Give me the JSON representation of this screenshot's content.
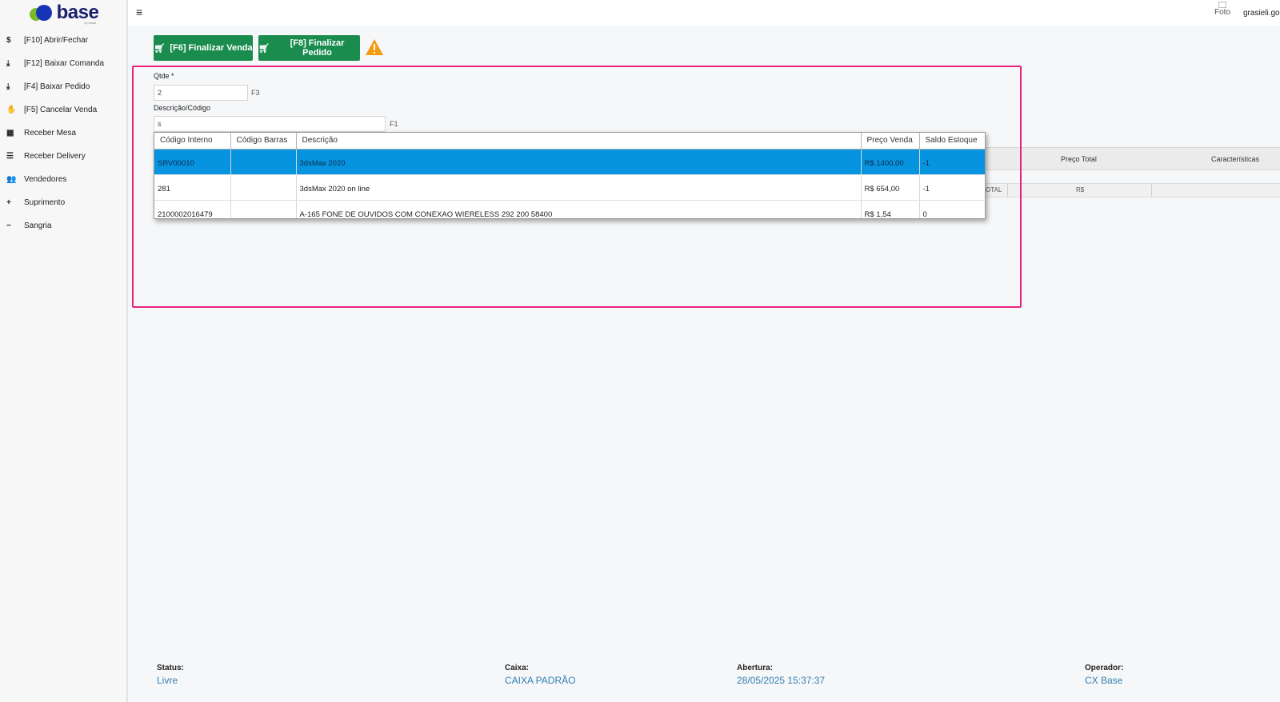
{
  "brand": {
    "logo_text": "base",
    "byline": "by Natal"
  },
  "sidebar": {
    "items": [
      {
        "icon": "dollar-icon",
        "glyph": "$",
        "label": "[F10] Abrir/Fechar"
      },
      {
        "icon": "download-icon",
        "glyph": "⤓",
        "label": "[F12] Baixar Comanda"
      },
      {
        "icon": "download-icon",
        "glyph": "⤓",
        "label": "[F4] Baixar Pedido"
      },
      {
        "icon": "thumbs-down-icon",
        "glyph": "✋",
        "label": "[F5] Cancelar Venda"
      },
      {
        "icon": "grid-icon",
        "glyph": "▦",
        "label": "Receber Mesa"
      },
      {
        "icon": "list-icon",
        "glyph": "☰",
        "label": "Receber Delivery"
      },
      {
        "icon": "users-icon",
        "glyph": "👥",
        "label": "Vendedores"
      },
      {
        "icon": "plus-icon",
        "glyph": "+",
        "label": "Suprimento"
      },
      {
        "icon": "minus-icon",
        "glyph": "−",
        "label": "Sangria"
      }
    ]
  },
  "header": {
    "hamburger": "≡",
    "photo_alt": "Foto",
    "user": "grasieli.gomes"
  },
  "actions": {
    "finalizar_venda": "[F6] Finalizar Venda",
    "finalizar_pedido": "[F8] Finalizar Pedido"
  },
  "form": {
    "qtde_label": "Qtde *",
    "qtde_value": "2",
    "qtde_hint": "F3",
    "desc_label": "Descrição/Código",
    "desc_value": "s",
    "desc_hint": "F1"
  },
  "background_table": {
    "headers": {
      "preco_total": "Preço Total",
      "caracteristicas": "Características"
    },
    "total_row": {
      "total": "OTAL",
      "currency": "R$"
    }
  },
  "autocomplete": {
    "columns": [
      "Código Interno",
      "Código Barras",
      "Descrição",
      "Preço Venda",
      "Saldo Estoque"
    ],
    "rows": [
      {
        "codigo_interno": "SRV00010",
        "codigo_barras": "",
        "descricao": "3dsMax 2020",
        "preco": "R$ 1400,00",
        "saldo": "-1",
        "selected": true
      },
      {
        "codigo_interno": "281",
        "codigo_barras": "",
        "descricao": "3dsMax 2020 on line",
        "preco": "R$ 654,00",
        "saldo": "-1",
        "selected": false
      },
      {
        "codigo_interno": "2100002016479",
        "codigo_barras": "",
        "descricao": "A-165 FONE DE OUVIDOS COM CONEXAO WIERELESS 292 200 58400",
        "preco": "R$ 1,54",
        "saldo": "0",
        "selected": false
      }
    ]
  },
  "footer": {
    "status_label": "Status:",
    "status_value": "Livre",
    "caixa_label": "Caixa:",
    "caixa_value": "CAIXA PADRÃO",
    "abertura_label": "Abertura:",
    "abertura_value": "28/05/2025 15:37:37",
    "operador_label": "Operador:",
    "operador_value": "CX Base"
  },
  "colors": {
    "primary_button": "#198c4e",
    "selected_row": "#0694e0",
    "highlight_border": "#e8247c",
    "warning": "#f39c12",
    "status_value": "#2f7fb0"
  }
}
